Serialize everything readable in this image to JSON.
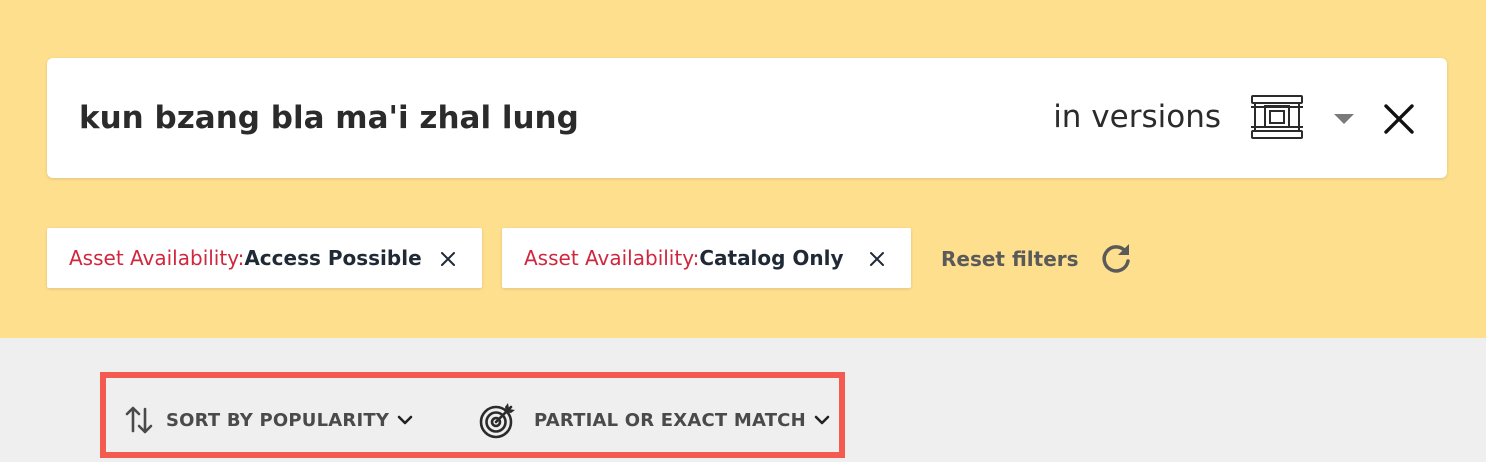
{
  "search": {
    "query": "kun bzang bla ma'i zhal lung",
    "scope_label": "in versions",
    "scope_icon": "versions-icon",
    "dropdown_icon": "caret-down-icon",
    "clear_icon": "close-icon"
  },
  "filters": {
    "chips": [
      {
        "key": "Asset Availability: ",
        "value": "Access Possible"
      },
      {
        "key": "Asset Availability: ",
        "value": "Catalog Only"
      }
    ],
    "reset_label": "Reset filters",
    "reset_icon": "refresh-icon"
  },
  "controls": {
    "sort_label": "SORT BY POPULARITY",
    "sort_icon": "sort-arrows-icon",
    "match_label": "PARTIAL OR EXACT MATCH",
    "match_icon": "target-icon"
  },
  "colors": {
    "search_background": "#fddf8e",
    "page_background": "#efefef",
    "chip_key": "#d0263e",
    "highlight_border": "#f35a50"
  }
}
